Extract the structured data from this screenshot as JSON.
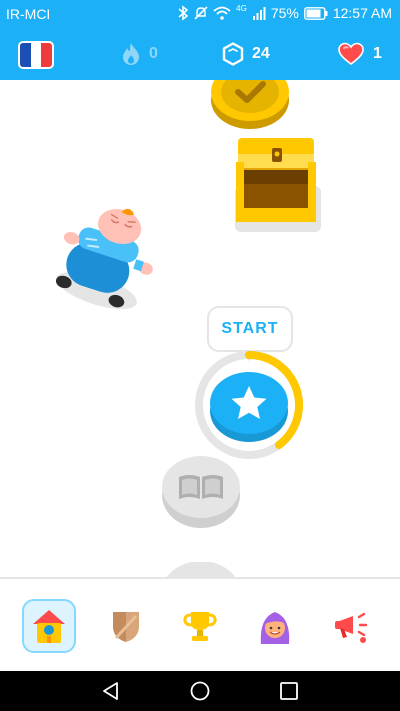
{
  "status_bar": {
    "carrier": "IR-MCI",
    "network": "4G",
    "battery": "75%",
    "time": "12:57 AM",
    "icons": [
      "bluetooth-icon",
      "silent-icon",
      "wifi-icon",
      "signal-icon",
      "battery-icon"
    ]
  },
  "header": {
    "course_flag": "france-flag",
    "streak_count": "0",
    "gems_count": "24",
    "hearts_count": "1"
  },
  "path": {
    "start_label": "START",
    "current_lesson_progress": 0.4
  },
  "tabs": [
    {
      "name": "learn",
      "icon": "home-birdhouse-icon",
      "active": true
    },
    {
      "name": "shield",
      "icon": "shield-icon",
      "active": false
    },
    {
      "name": "leaderboard",
      "icon": "trophy-icon",
      "active": false
    },
    {
      "name": "profile",
      "icon": "avatar-icon",
      "active": false
    },
    {
      "name": "news",
      "icon": "megaphone-icon",
      "active": false
    }
  ],
  "colors": {
    "brand_blue": "#1cb0f6",
    "gold": "#ffc800",
    "heart_red": "#ff4b4b",
    "border_gray": "#e5e5e5"
  }
}
